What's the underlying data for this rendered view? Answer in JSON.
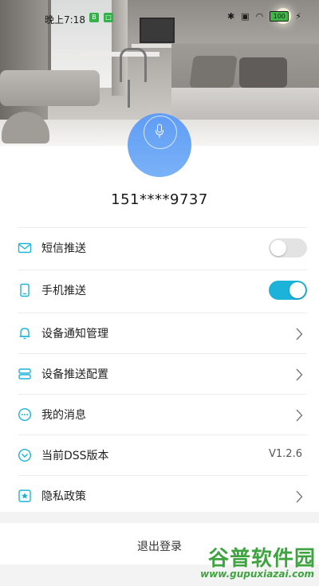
{
  "status_bar": {
    "time": "晚上7:18",
    "battery": "100"
  },
  "profile": {
    "phone": "151****9737"
  },
  "menu": {
    "sms_push": {
      "label": "短信推送",
      "enabled": false
    },
    "phone_push": {
      "label": "手机推送",
      "enabled": true
    },
    "device_notify": {
      "label": "设备通知管理"
    },
    "device_push_config": {
      "label": "设备推送配置"
    },
    "my_messages": {
      "label": "我的消息"
    },
    "dss_version": {
      "label": "当前DSS版本",
      "value": "V1.2.6"
    },
    "privacy": {
      "label": "隐私政策"
    }
  },
  "logout_label": "退出登录",
  "watermark": {
    "title": "谷普软件园",
    "url": "www.gupuxiazai.com"
  },
  "colors": {
    "accent": "#1cb3d9",
    "avatar": "#6aa7f6",
    "watermark": "#3fa340"
  }
}
